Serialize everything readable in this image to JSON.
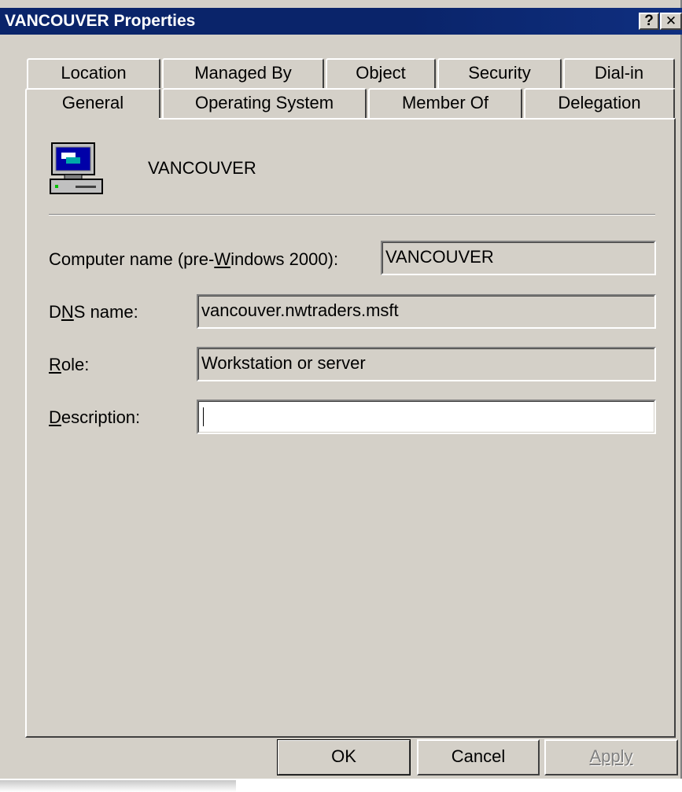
{
  "window": {
    "title": "VANCOUVER Properties",
    "help_button": "?",
    "close_button": "✕"
  },
  "tabs": {
    "back_row": [
      "Location",
      "Managed By",
      "Object",
      "Security",
      "Dial-in"
    ],
    "front_row": [
      "General",
      "Operating System",
      "Member Of",
      "Delegation"
    ],
    "active": "General"
  },
  "general": {
    "icon": "computer-icon",
    "computer_name": "VANCOUVER",
    "fields": {
      "prewin2000": {
        "label_pre": "Computer name (pre-",
        "label_accel": "W",
        "label_post": "indows 2000):",
        "value": "VANCOUVER"
      },
      "dns": {
        "label_pre": "D",
        "label_accel": "N",
        "label_post": "S name:",
        "value": "vancouver.nwtraders.msft"
      },
      "role": {
        "label_pre": "",
        "label_accel": "R",
        "label_post": "ole:",
        "value": "Workstation or server"
      },
      "description": {
        "label_pre": "",
        "label_accel": "D",
        "label_post": "escription:",
        "value": ""
      }
    }
  },
  "buttons": {
    "ok": "OK",
    "cancel": "Cancel",
    "apply": "Apply"
  },
  "colors": {
    "titlebar": "#0a246a",
    "dialog_face": "#d4d0c8",
    "screen_blue": "#0000a8"
  }
}
